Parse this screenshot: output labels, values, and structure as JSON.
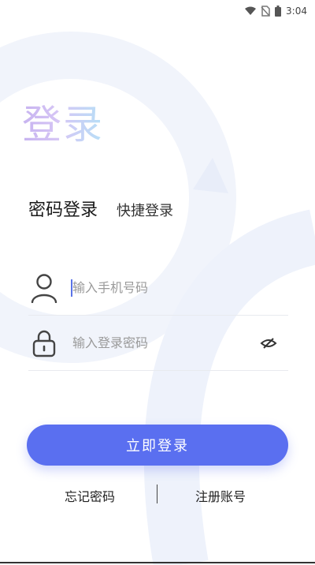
{
  "status_bar": {
    "time": "3:04",
    "icons": [
      "wifi-icon",
      "no-sim-icon",
      "battery-icon"
    ]
  },
  "title": "登录",
  "tabs": {
    "active": "密码登录",
    "other": "快捷登录"
  },
  "phone_field": {
    "placeholder": "输入手机号码",
    "icon": "user-icon"
  },
  "password_field": {
    "placeholder": "输入登录密码",
    "icon": "lock-icon",
    "toggle_icon": "eye-off-icon"
  },
  "login_button": {
    "label": "立即登录"
  },
  "links": {
    "forgot": "忘记密码",
    "register": "注册账号"
  },
  "colors": {
    "primary": "#5a6ff0",
    "title_gradient_start": "#c7b3f0",
    "title_gradient_end": "#b6e0f7",
    "decor": "#eef2fb"
  }
}
